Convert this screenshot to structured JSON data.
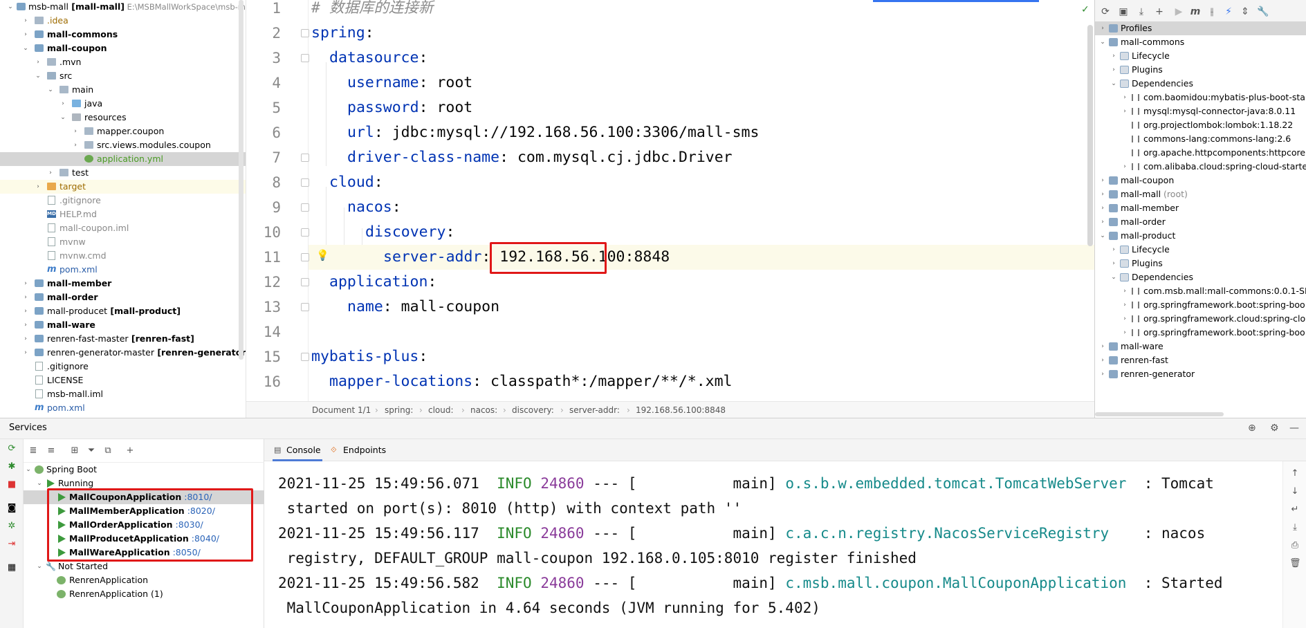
{
  "project": {
    "rows": [
      {
        "label": "msb-mall",
        "bold": " [mall-mall]",
        "note": " E:\\MSBMallWorkSpace\\msb-m"
      },
      {
        "label": ".idea"
      },
      {
        "label": "mall-commons"
      },
      {
        "label": "mall-coupon"
      },
      {
        "label": ".mvn"
      },
      {
        "label": "src"
      },
      {
        "label": "main"
      },
      {
        "label": "java"
      },
      {
        "label": "resources"
      },
      {
        "label": "mapper.coupon"
      },
      {
        "label": "src.views.modules.coupon"
      },
      {
        "label": "application.yml"
      },
      {
        "label": "test"
      },
      {
        "label": "target"
      },
      {
        "label": ".gitignore"
      },
      {
        "label": "HELP.md"
      },
      {
        "label": "mall-coupon.iml"
      },
      {
        "label": "mvnw"
      },
      {
        "label": "mvnw.cmd"
      },
      {
        "label": "pom.xml"
      },
      {
        "label": "mall-member"
      },
      {
        "label": "mall-order"
      },
      {
        "label": "mall-producet",
        "bold": " [mall-product]"
      },
      {
        "label": "mall-ware"
      },
      {
        "label": "renren-fast-master",
        "bold": " [renren-fast]"
      },
      {
        "label": "renren-generator-master",
        "bold": " [renren-generator]"
      },
      {
        "label": ".gitignore"
      },
      {
        "label": "LICENSE"
      },
      {
        "label": "msb-mall.iml"
      },
      {
        "label": "pom.xml"
      }
    ]
  },
  "editor": {
    "lines": [
      {
        "n": "1",
        "comment": "# 数据库的连接新"
      },
      {
        "n": "2",
        "key": "spring",
        "val": ""
      },
      {
        "n": "3",
        "key": "datasource",
        "val": ""
      },
      {
        "n": "4",
        "key": "username",
        "val": " root"
      },
      {
        "n": "5",
        "key": "password",
        "val": " root"
      },
      {
        "n": "6",
        "key": "url",
        "val": " jdbc:mysql://192.168.56.100:3306/mall-sms"
      },
      {
        "n": "7",
        "key": "driver-class-name",
        "val": " com.mysql.cj.jdbc.Driver"
      },
      {
        "n": "8",
        "key": "cloud",
        "val": ""
      },
      {
        "n": "9",
        "key": "nacos",
        "val": ""
      },
      {
        "n": "10",
        "key": "discovery",
        "val": ""
      },
      {
        "n": "11",
        "key": "server-addr",
        "val": " 192.168.56.100:8848"
      },
      {
        "n": "12",
        "key": "application",
        "val": ""
      },
      {
        "n": "13",
        "key": "name",
        "val": " mall-coupon"
      },
      {
        "n": "14",
        "key": "",
        "val": ""
      },
      {
        "n": "15",
        "key": "mybatis-plus",
        "val": ""
      },
      {
        "n": "16",
        "key": "mapper-locations",
        "val": " classpath*:/mapper/**/*.xml"
      }
    ],
    "breadcrumbs": [
      "Document 1/1",
      "spring:",
      "cloud:",
      "nacos:",
      "discovery:",
      "server-addr:",
      "192.168.56.100:8848"
    ]
  },
  "maven": {
    "rows": [
      {
        "label": "Profiles"
      },
      {
        "label": "mall-commons"
      },
      {
        "label": "Lifecycle"
      },
      {
        "label": "Plugins"
      },
      {
        "label": "Dependencies"
      },
      {
        "label": "com.baomidou:mybatis-plus-boot-sta"
      },
      {
        "label": "mysql:mysql-connector-java:8.0.11"
      },
      {
        "label": "org.projectlombok:lombok:1.18.22"
      },
      {
        "label": "commons-lang:commons-lang:2.6"
      },
      {
        "label": "org.apache.httpcomponents:httpcore:"
      },
      {
        "label": "com.alibaba.cloud:spring-cloud-starte"
      },
      {
        "label": "mall-coupon"
      },
      {
        "label": "mall-mall",
        "note": " (root)"
      },
      {
        "label": "mall-member"
      },
      {
        "label": "mall-order"
      },
      {
        "label": "mall-product"
      },
      {
        "label": "Lifecycle"
      },
      {
        "label": "Plugins"
      },
      {
        "label": "Dependencies"
      },
      {
        "label": "com.msb.mall:mall-commons:0.0.1-SN"
      },
      {
        "label": "org.springframework.boot:spring-boo"
      },
      {
        "label": "org.springframework.cloud:spring-clo"
      },
      {
        "label": "org.springframework.boot:spring-boo"
      },
      {
        "label": "mall-ware"
      },
      {
        "label": "renren-fast"
      },
      {
        "label": "renren-generator"
      }
    ]
  },
  "services": {
    "title": "Services",
    "tree": [
      {
        "label": "Spring Boot"
      },
      {
        "label": "Running"
      },
      {
        "label": "MallCouponApplication",
        "port": " :8010/"
      },
      {
        "label": "MallMemberApplication",
        "port": " :8020/"
      },
      {
        "label": "MallOrderApplication",
        "port": " :8030/"
      },
      {
        "label": "MallProducetApplication",
        "port": " :8040/"
      },
      {
        "label": "MallWareApplication",
        "port": " :8050/"
      },
      {
        "label": "Not Started"
      },
      {
        "label": "RenrenApplication"
      },
      {
        "label": "RenrenApplication (1)"
      }
    ],
    "tabs": [
      "Console",
      "Endpoints"
    ],
    "console": [
      {
        "ts": "2021-11-25 15:49:56.071",
        "level": "INFO",
        "pid": "24860",
        "mid": " --- [           main] ",
        "cls": "o.s.b.w.embedded.tomcat.TomcatWebServer",
        "msg": "  : Tomcat"
      },
      {
        "cont": " started on port(s): 8010 (http) with context path ''"
      },
      {
        "ts": "2021-11-25 15:49:56.117",
        "level": "INFO",
        "pid": "24860",
        "mid": " --- [           main] ",
        "cls": "c.a.c.n.registry.NacosServiceRegistry",
        "msg": "    : nacos"
      },
      {
        "cont": " registry, DEFAULT_GROUP mall-coupon 192.168.0.105:8010 register finished"
      },
      {
        "ts": "2021-11-25 15:49:56.582",
        "level": "INFO",
        "pid": "24860",
        "mid": " --- [           main] ",
        "cls": "c.msb.mall.coupon.MallCouponApplication",
        "msg": "  : Started"
      },
      {
        "cont": " MallCouponApplication in 4.64 seconds (JVM running for 5.402)"
      }
    ]
  },
  "colors": {
    "highlight_red": "#e01818",
    "yaml_key": "#0033b3",
    "log_info": "#2a8a2a",
    "log_class": "#168a8a"
  }
}
